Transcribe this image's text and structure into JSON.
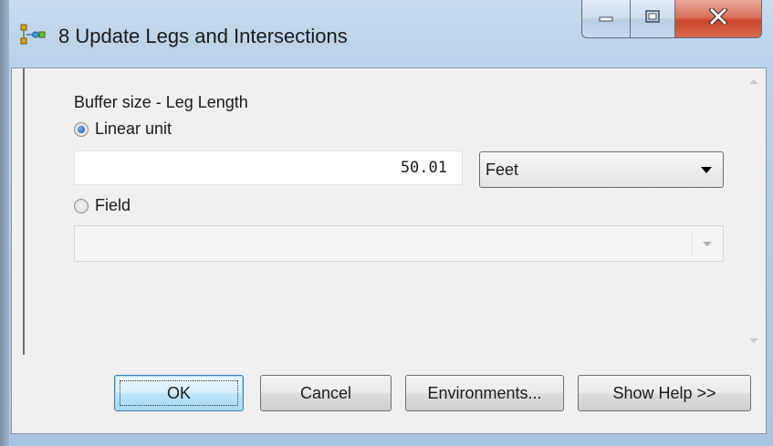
{
  "window": {
    "title": "8 Update Legs and Intersections",
    "icon": "model-tool-icon",
    "controls": {
      "minimize_icon": "minimize-icon",
      "maximize_icon": "maximize-icon",
      "close_icon": "close-icon"
    }
  },
  "form": {
    "section_label": "Buffer size - Leg Length",
    "linear_unit": {
      "label": "Linear unit",
      "checked": true,
      "value": "50.01",
      "unit": "Feet"
    },
    "field": {
      "label": "Field",
      "checked": false,
      "value": ""
    }
  },
  "buttons": {
    "ok": "OK",
    "cancel": "Cancel",
    "environments": "Environments...",
    "show_help": "Show Help >>"
  },
  "colors": {
    "close_button": "#c9452a",
    "radio_selected": "#1f5fb0",
    "default_button_border": "#3c7fb1"
  }
}
